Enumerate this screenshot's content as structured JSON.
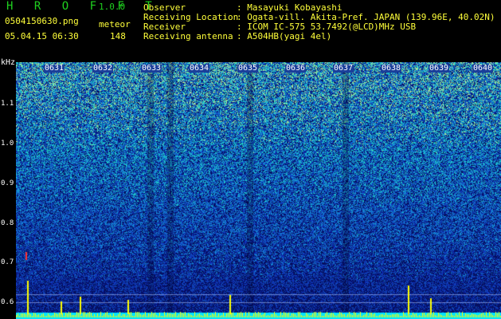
{
  "header": {
    "app_title": "H R O F F T",
    "version": "1.0.0",
    "file_name": "0504150630.png",
    "meteor_label": "meteor",
    "date_time": "05.04.15 06:30",
    "meteor_count": "148",
    "info": [
      {
        "label": "Observer",
        "value": ": Masayuki Kobayashi"
      },
      {
        "label": "Receiving Location",
        "value": ": Ogata-vill. Akita-Pref. JAPAN (139.96E, 40.02N)"
      },
      {
        "label": "Receiver",
        "value": ": ICOM IC-575 53.7492(@LCD)MHz USB"
      },
      {
        "label": "Receiving antenna",
        "value": ": A504HB(yagi 4el)"
      }
    ]
  },
  "plot": {
    "y_axis_unit": "kHz",
    "y_ticks": [
      "1.1",
      "1.0",
      "0.9",
      "0.8",
      "0.7",
      "0.6"
    ],
    "time_labels": [
      "0631",
      "0632",
      "0633",
      "0634",
      "0635",
      "0636",
      "0637",
      "0638",
      "0639",
      "0640"
    ],
    "colors": {
      "background": "#000000",
      "label_green": "#1fd11f",
      "label_yellow": "#ffff3a",
      "noise_low": "#0b1f8a",
      "noise_mid": "#1d7fd6",
      "noise_high": "#3ee0a0",
      "signal": "#ffff00",
      "bottom_band": "#00e5ff",
      "meteor_trace": "#ff3333"
    }
  }
}
